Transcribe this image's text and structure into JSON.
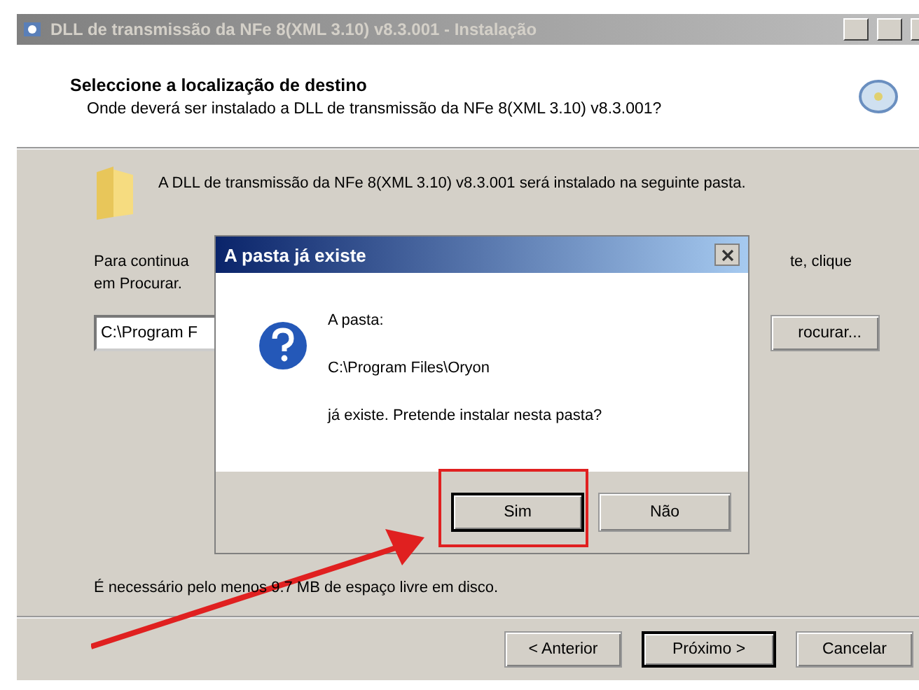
{
  "window": {
    "title": "DLL de transmissão da NFe 8(XML 3.10) v8.3.001 - Instalação",
    "active": false
  },
  "header": {
    "title": "Seleccione a localização de destino",
    "subtitle": "Onde deverá ser instalado a DLL de transmissão da NFe 8(XML 3.10) v8.3.001?"
  },
  "body": {
    "install_text": "A DLL de transmissão da NFe 8(XML 3.10) v8.3.001 será instalado na seguinte pasta.",
    "continue_left": "Para continua",
    "continue_right": "te, clique",
    "continue_line2": "em Procurar.",
    "path_value": "C:\\Program F",
    "browse_button": "rocurar...",
    "space_text": "É necessário pelo menos 9.7 MB de espaço livre em disco."
  },
  "footer_buttons": [
    {
      "label": "< Anterior",
      "default": false
    },
    {
      "label": "Próximo >",
      "default": true
    },
    {
      "label": "Cancelar",
      "default": false
    }
  ],
  "dialog": {
    "title": "A pasta já existe",
    "lines": [
      "A pasta:",
      "C:\\Program Files\\Oryon",
      "já existe. Pretende instalar nesta pasta?"
    ],
    "buttons": [
      {
        "label": "Sim",
        "default": true
      },
      {
        "label": "Não",
        "default": false
      }
    ]
  }
}
